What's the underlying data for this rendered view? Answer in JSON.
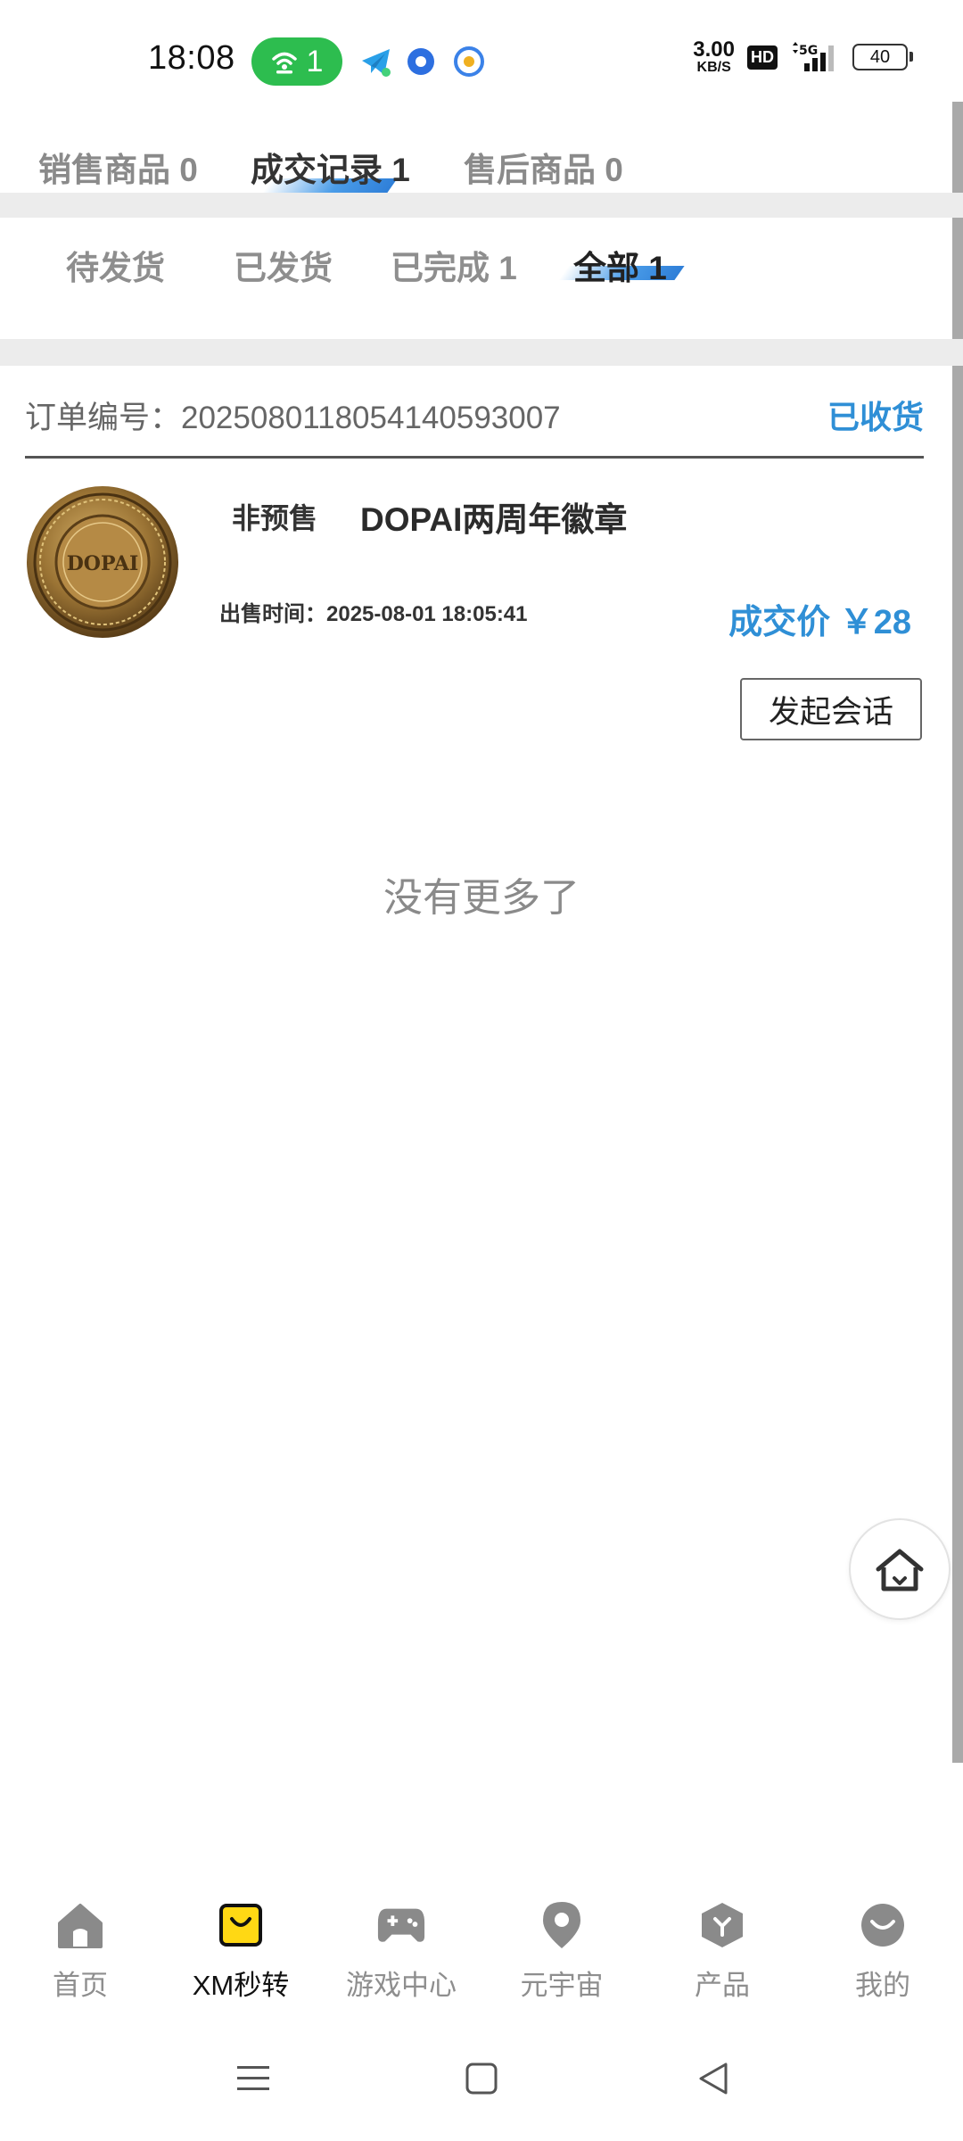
{
  "status_bar": {
    "time": "18:08",
    "hotspot_count": "1",
    "net_speed_value": "3.00",
    "net_speed_unit": "KB/S",
    "hd_label": "HD",
    "signal_label": "5G",
    "battery": "40"
  },
  "tabs": {
    "items": [
      {
        "label": "销售商品 0"
      },
      {
        "label": "成交记录 1"
      },
      {
        "label": "售后商品 0"
      }
    ],
    "active": "成交记录 1"
  },
  "sub_tabs": {
    "items": [
      {
        "label": "待发货"
      },
      {
        "label": "已发货"
      },
      {
        "label": "已完成  1"
      },
      {
        "label": "全部  1"
      }
    ],
    "active": "全部  1"
  },
  "order": {
    "number_label": "订单编号：",
    "number": "20250801180541405930​07",
    "number_full": "订单编号：2025080118054140593007",
    "status": "已收货",
    "presale_tag": "非预售",
    "product_name": "DOPAI两周年徽章",
    "sale_time_label": "出售时间：",
    "sale_time": "2025-08-01 18:05:41",
    "price_label": "成交价 ￥28",
    "chat_button": "发起会话",
    "coin_text": "DOPAI"
  },
  "list_end_text": "没有更多了",
  "bottom_nav": {
    "items": [
      {
        "label": "首页",
        "icon": "home-icon"
      },
      {
        "label": "XM秒转",
        "icon": "shopping-bag-icon"
      },
      {
        "label": "游戏中心",
        "icon": "gamepad-icon"
      },
      {
        "label": "元宇宙",
        "icon": "location-pin-icon"
      },
      {
        "label": "产品",
        "icon": "cube-icon"
      },
      {
        "label": "我的",
        "icon": "smile-profile-icon"
      }
    ],
    "active": "XM秒转"
  },
  "colors": {
    "accent_blue": "#2f8fd6",
    "hotspot_green": "#2dbd4f",
    "active_nav_yellow": "#ffd814"
  }
}
